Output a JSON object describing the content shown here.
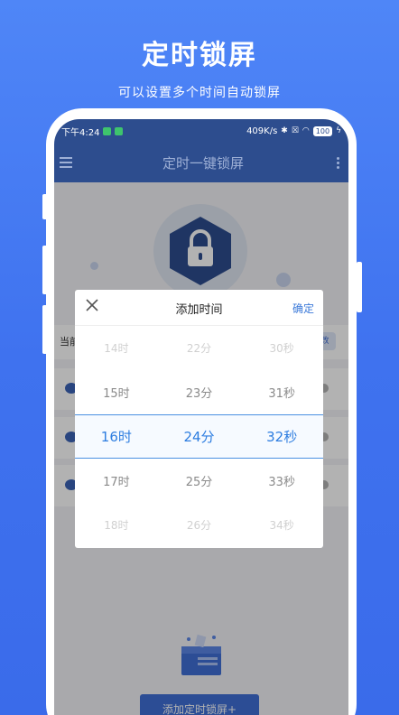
{
  "hero": {
    "title": "定时锁屏",
    "subtitle": "可以设置多个时间自动锁屏"
  },
  "statusbar": {
    "time": "下午4:24",
    "speed": "409K/s",
    "battery": "100"
  },
  "appbar": {
    "title": "定时一键锁屏"
  },
  "main": {
    "current_label": "当前",
    "edit_label": "改",
    "add_button_label": "添加定时锁屏+"
  },
  "dialog": {
    "title": "添加时间",
    "confirm_label": "确定",
    "selected": {
      "hour": "16时",
      "minute": "24分",
      "second": "32秒"
    },
    "rows": [
      {
        "hour": "14时",
        "minute": "22分",
        "second": "30秒"
      },
      {
        "hour": "15时",
        "minute": "23分",
        "second": "31秒"
      },
      {
        "hour": "16时",
        "minute": "24分",
        "second": "32秒"
      },
      {
        "hour": "17时",
        "minute": "25分",
        "second": "33秒"
      },
      {
        "hour": "18时",
        "minute": "26分",
        "second": "34秒"
      }
    ]
  },
  "colors": {
    "brand_blue": "#3f72ef",
    "appbar": "#2d4d8e",
    "accent": "#2d7de0"
  }
}
